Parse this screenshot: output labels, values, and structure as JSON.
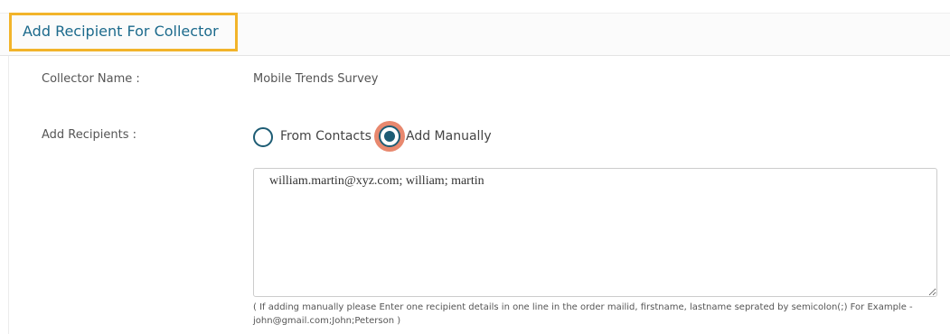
{
  "header": {
    "title": "Add Recipient For Collector"
  },
  "form": {
    "collector_name_label": "Collector Name :",
    "collector_name_value": "Mobile Trends Survey",
    "add_recipients_label": "Add Recipients :",
    "options": [
      {
        "label": "From Contacts",
        "selected": false
      },
      {
        "label": "Add Manually",
        "selected": true
      }
    ],
    "recipients_text": "william.martin@xyz.com; william; martin",
    "help_text": "( If adding manually please Enter one recipient details in one line in the order mailid, firstname, lastname seprated by semicolon(;) For Example - john@gmail.com;John;Peterson )"
  },
  "colors": {
    "title": "#1c6a8c",
    "highlight_border": "#f2b42a",
    "radio": "#1d5c74",
    "click_halo": "#e8886e"
  }
}
